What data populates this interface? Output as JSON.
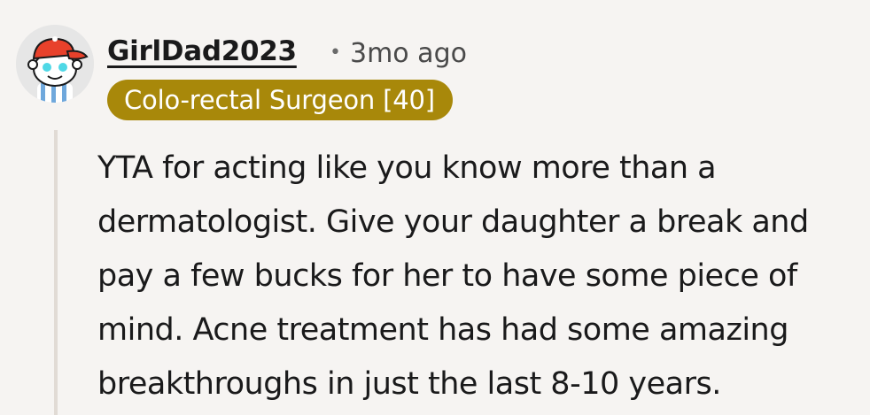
{
  "comment": {
    "author": "GirlDad2023",
    "timestamp": "3mo ago",
    "separator": "•",
    "flair": "Colo-rectal Surgeon [40]",
    "body": "YTA for acting like you know more than a dermatologist. Give your daughter a break and pay a few bucks for her to have some piece of mind. Acne treatment has had some amazing breakthroughs in just the last 8-10 years."
  },
  "avatar": {
    "icon": "reddit-snoo-avatar-icon"
  },
  "colors": {
    "background": "#f6f4f2",
    "flair_background": "#a8880a",
    "flair_text": "#ffffff",
    "thread_line": "#e1dbd5",
    "avatar_cap": "#e8412b",
    "avatar_eye": "#4fd8e6"
  }
}
